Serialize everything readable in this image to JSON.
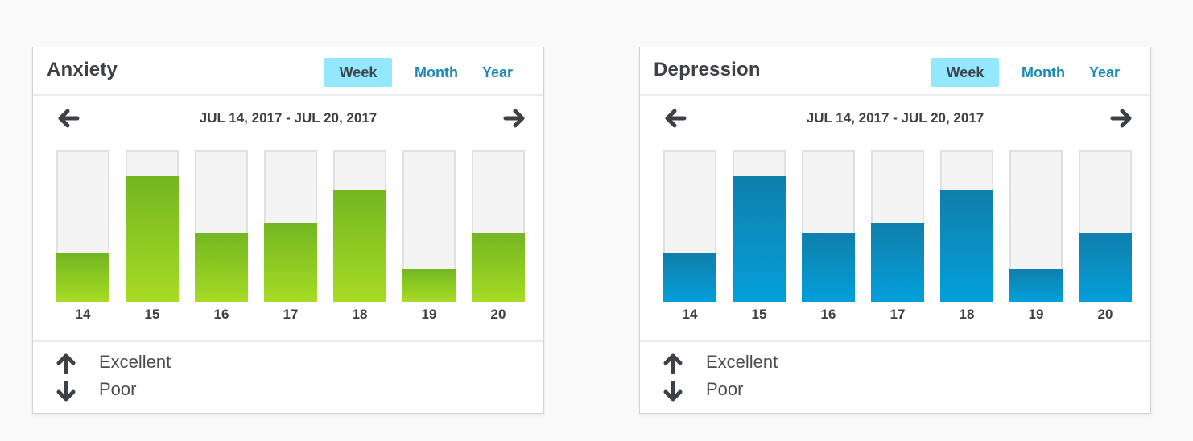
{
  "colors": {
    "background": "#f9f9f9",
    "active_tab_bg": "#93e8fe",
    "tab_link": "#1a88b4",
    "anxiety_bar_top": "#73b622",
    "anxiety_bar_bottom": "#a8db26",
    "depression_bar_top": "#0e7fab",
    "depression_bar_bottom": "#029fda",
    "track": "#f4f4f4",
    "text": "#3d4045"
  },
  "cards": [
    {
      "title": "Anxiety",
      "tabs": [
        {
          "label": "Week",
          "active": true
        },
        {
          "label": "Month",
          "active": false
        },
        {
          "label": "Year",
          "active": false
        }
      ],
      "date_range": "JUL 14, 2017 - JUL 20, 2017",
      "prev_icon": "arrow-left-icon",
      "next_icon": "arrow-right-icon",
      "legend": [
        {
          "icon": "arrow-up-icon",
          "label": "Excellent"
        },
        {
          "icon": "arrow-down-icon",
          "label": "Poor"
        }
      ]
    },
    {
      "title": "Depression",
      "tabs": [
        {
          "label": "Week",
          "active": true
        },
        {
          "label": "Month",
          "active": false
        },
        {
          "label": "Year",
          "active": false
        }
      ],
      "date_range": "JUL 14, 2017 - JUL 20, 2017",
      "prev_icon": "arrow-left-icon",
      "next_icon": "arrow-right-icon",
      "legend": [
        {
          "icon": "arrow-up-icon",
          "label": "Excellent"
        },
        {
          "icon": "arrow-down-icon",
          "label": "Poor"
        }
      ]
    }
  ],
  "chart_data": [
    {
      "type": "bar",
      "title": "Anxiety",
      "categories": [
        "14",
        "15",
        "16",
        "17",
        "18",
        "19",
        "20"
      ],
      "values": [
        0.32,
        0.83,
        0.45,
        0.52,
        0.74,
        0.22,
        0.45
      ],
      "ylim": [
        0,
        1
      ],
      "ylabel": "",
      "xlabel": "",
      "scale_top_label": "Excellent",
      "scale_bottom_label": "Poor",
      "grid": false,
      "legend": "bottom-left"
    },
    {
      "type": "bar",
      "title": "Depression",
      "categories": [
        "14",
        "15",
        "16",
        "17",
        "18",
        "19",
        "20"
      ],
      "values": [
        0.32,
        0.83,
        0.45,
        0.52,
        0.74,
        0.22,
        0.45
      ],
      "ylim": [
        0,
        1
      ],
      "ylabel": "",
      "xlabel": "",
      "scale_top_label": "Excellent",
      "scale_bottom_label": "Poor",
      "grid": false,
      "legend": "bottom-left"
    }
  ]
}
